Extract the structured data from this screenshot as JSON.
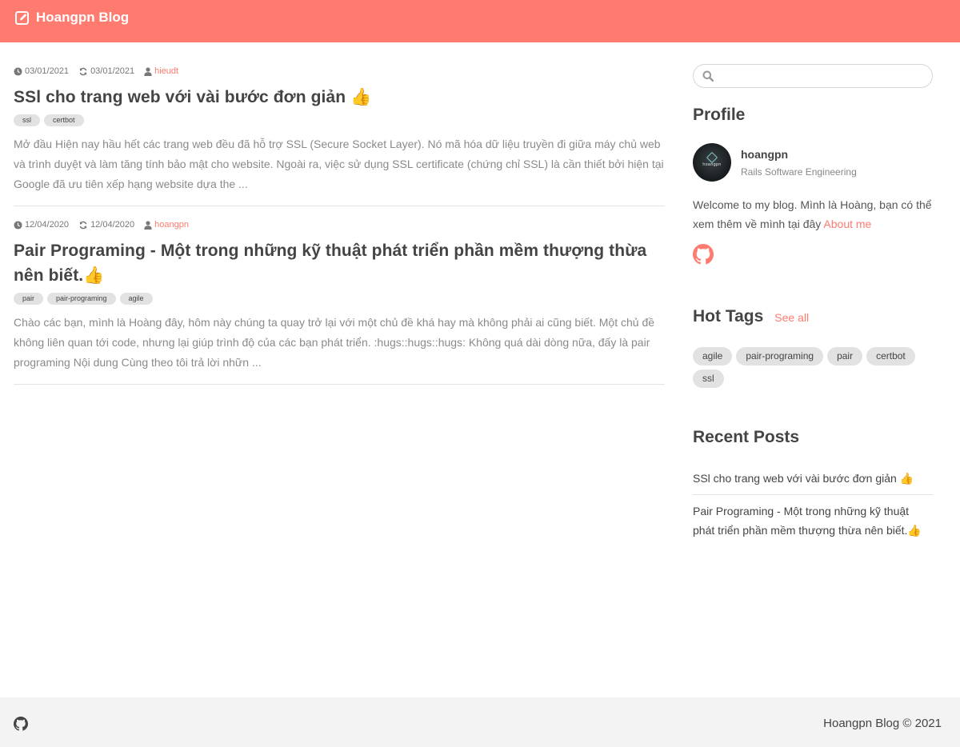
{
  "header": {
    "brand": "Hoangpn Blog",
    "brand_icon": "edit-square-icon",
    "accent_color": "#ff7b70"
  },
  "posts": [
    {
      "created": "03/01/2021",
      "updated": "03/01/2021",
      "author": "hieudt",
      "title": "SSl cho trang web với vài bước đơn giản 👍",
      "tags": [
        "ssl",
        "certbot"
      ],
      "excerpt": "Mở đầu Hiện nay hầu hết các trang web đều đã hỗ trợ SSL (Secure Socket Layer). Nó mã hóa dữ liệu truyền đi giữa máy chủ web và trình duyệt và làm tăng tính bảo mật cho website. Ngoài ra, việc sử dụng SSL certificate (chứng chỉ SSL) là cần thiết bởi hiện tại Google đã ưu tiên xếp hạng website dựa the ..."
    },
    {
      "created": "12/04/2020",
      "updated": "12/04/2020",
      "author": "hoangpn",
      "title": "Pair Programing - Một trong những kỹ thuật phát triển phần mềm thượng thừa nên biết.👍",
      "tags": [
        "pair",
        "pair-programing",
        "agile"
      ],
      "excerpt": "Chào các bạn, mình là Hoàng đây, hôm này chúng ta quay trở lại với một chủ đề khá hay mà không phải ai cũng biết. Một chủ đề không liên quan tới code, nhưng lại giúp trình độ của các bạn phát triển. :hugs::hugs::hugs: Không quá dài dòng nữa, đấy là pair programing Nội dung Cùng theo tôi trả lời nhữn ..."
    }
  ],
  "sidebar": {
    "search_placeholder": "",
    "profile": {
      "heading": "Profile",
      "name": "hoangpn",
      "role": "Rails Software Engineering",
      "avatar_text": "hoangpn",
      "welcome": "Welcome to my blog. Mình là Hoàng, bạn có thể xem thêm về mình tại đây ",
      "about_link": "About me"
    },
    "hot_tags": {
      "heading": "Hot Tags",
      "see_all": "See all",
      "tags": [
        "agile",
        "pair-programing",
        "pair",
        "certbot",
        "ssl"
      ]
    },
    "recent_posts": {
      "heading": "Recent Posts",
      "items": [
        "SSl cho trang web với vài bước đơn giản 👍",
        "Pair Programing - Một trong những kỹ thuật phát triển phần mềm thượng thừa nên biết.👍"
      ]
    }
  },
  "footer": {
    "copyright": "Hoangpn Blog © 2021"
  }
}
